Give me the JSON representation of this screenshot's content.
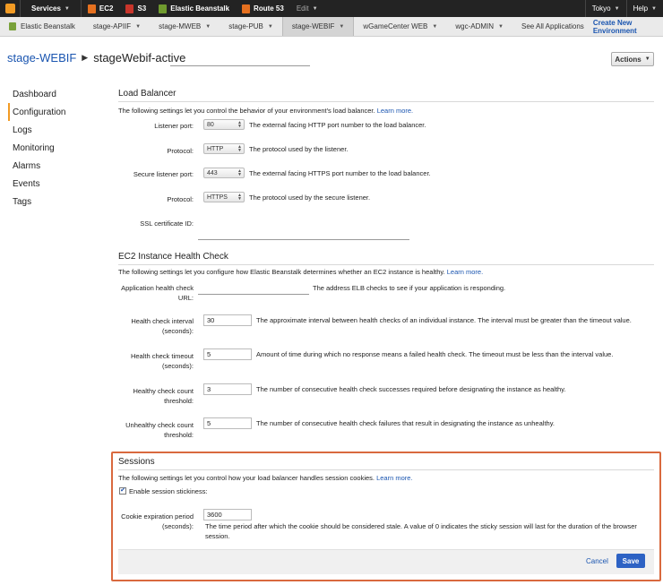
{
  "topnav": {
    "services": "Services",
    "ec2": "EC2",
    "s3": "S3",
    "beanstalk": "Elastic Beanstalk",
    "route53": "Route 53",
    "edit": "Edit",
    "region": "Tokyo",
    "help": "Help"
  },
  "subnav": {
    "home": "Elastic Beanstalk",
    "apps": [
      "stage-APIIF",
      "stage-MWEB",
      "stage-PUB",
      "stage-WEBIF",
      "wGameCenter WEB",
      "wgc-ADMIN"
    ],
    "see_all": "See All Applications",
    "create": "Create New Environment"
  },
  "breadcrumb": {
    "app": "stage-WEBIF",
    "env": "stageWebif-active"
  },
  "actions_label": "Actions",
  "leftnav": [
    "Dashboard",
    "Configuration",
    "Logs",
    "Monitoring",
    "Alarms",
    "Events",
    "Tags"
  ],
  "load_balancer": {
    "title": "Load Balancer",
    "desc": "The following settings let you control the behavior of your environment's load balancer.",
    "learn_more": "Learn more.",
    "listener_port": {
      "label": "Listener port:",
      "value": "80",
      "help": "The external facing HTTP port number to the load balancer."
    },
    "protocol": {
      "label": "Protocol:",
      "value": "HTTP",
      "help": "The protocol used by the listener."
    },
    "secure_port": {
      "label": "Secure listener port:",
      "value": "443",
      "help": "The external facing HTTPS port number to the load balancer."
    },
    "secure_protocol": {
      "label": "Protocol:",
      "value": "HTTPS",
      "help": "The protocol used by the secure listener."
    },
    "ssl_cert": {
      "label": "SSL certificate ID:"
    }
  },
  "health_check": {
    "title": "EC2 Instance Health Check",
    "desc": "The following settings let you configure how Elastic Beanstalk determines whether an EC2 instance is healthy.",
    "learn_more": "Learn more.",
    "url": {
      "label1": "Application health check",
      "label2": "URL:",
      "help": "The address ELB checks to see if your application is responding."
    },
    "interval": {
      "label1": "Health check interval",
      "label2": "(seconds):",
      "value": "30",
      "help": "The approximate interval between health checks of an individual instance. The interval must be greater than the timeout value."
    },
    "timeout": {
      "label1": "Health check timeout",
      "label2": "(seconds):",
      "value": "5",
      "help": "Amount of time during which no response means a failed health check. The timeout must be less than the interval value."
    },
    "healthy": {
      "label1": "Healthy check count",
      "label2": "threshold:",
      "value": "3",
      "help": "The number of consecutive health check successes required before designating the instance as healthy."
    },
    "unhealthy": {
      "label1": "Unhealthy check count",
      "label2": "threshold:",
      "value": "5",
      "help": "The number of consecutive health check failures that result in designating the instance as unhealthy."
    }
  },
  "sessions": {
    "title": "Sessions",
    "desc": "The following settings let you control how your load balancer handles session cookies.",
    "learn_more": "Learn more.",
    "stickiness_label": "Enable session stickiness:",
    "stickiness_checked": true,
    "cookie": {
      "label1": "Cookie expiration period",
      "label2": "(seconds):",
      "value": "3600",
      "help1": "The time period after which the cookie should be considered stale. A value of 0 indicates the sticky session will last for the duration of the browser",
      "help2": "session."
    },
    "cancel": "Cancel",
    "save": "Save"
  },
  "colors": {
    "accent_orange": "#f29b24",
    "link_blue": "#1a55b0",
    "save_blue": "#2d62c4",
    "highlight_border": "#d9693e"
  }
}
